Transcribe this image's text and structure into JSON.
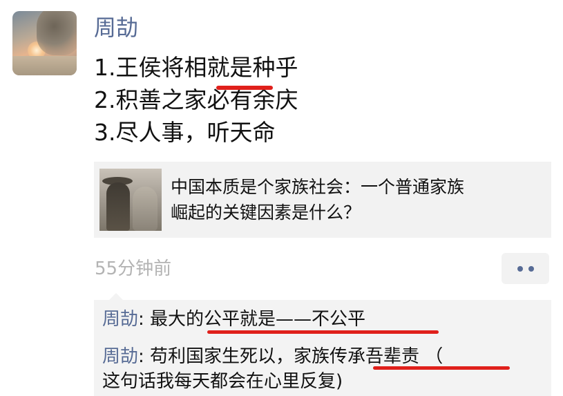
{
  "post": {
    "author": "周劼",
    "lines": [
      "1.王侯将相就是种乎",
      "2.积善之家必有余庆",
      "3.尽人事，听天命"
    ],
    "time": "55分钟前"
  },
  "shared_link": {
    "title_line1": "中国本质是个家族社会：一个普通家族",
    "title_line2": "崛起的关键因素是什么？"
  },
  "comments": [
    {
      "name": "周劼",
      "sep": ": ",
      "text": "最大的公平就是——不公平"
    },
    {
      "name": "周劼",
      "sep": ": ",
      "text": "苟利国家生死以，家族传承吾辈责 （",
      "text2": "这句话我每天都会在心里反复)"
    }
  ],
  "colors": {
    "link_blue": "#576b95",
    "underline_red": "#e0201b",
    "time_gray": "#b3b3b3",
    "panel_bg": "#f3f3f3"
  }
}
